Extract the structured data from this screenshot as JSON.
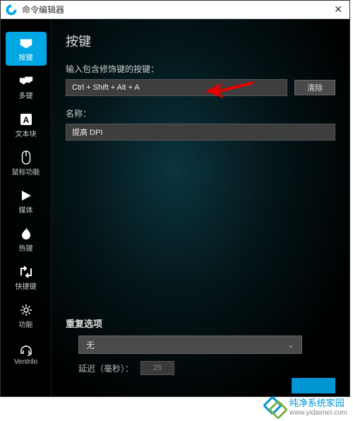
{
  "titlebar": {
    "title": "命令编辑器"
  },
  "sidebar": {
    "items": [
      {
        "label": "按键"
      },
      {
        "label": "多键"
      },
      {
        "label": "文本块"
      },
      {
        "label": "鼠标功能"
      },
      {
        "label": "媒体"
      },
      {
        "label": "热键"
      },
      {
        "label": "快捷键"
      },
      {
        "label": "功能"
      },
      {
        "label": "Ventrilo"
      }
    ]
  },
  "main": {
    "title": "按键",
    "keystroke_label": "输入包含修饰键的按键：",
    "keystroke_value": "Ctrl + Shift + Alt + A",
    "clear_label": "清除",
    "name_label": "名称：",
    "name_value": "提高 DPI"
  },
  "repeat": {
    "title": "重复选项",
    "dropdown_value": "无",
    "delay_label": "延迟（毫秒）：",
    "delay_value": "25"
  },
  "watermark": {
    "text": "纯净系统家园",
    "url": "www.yidaimei.com"
  }
}
